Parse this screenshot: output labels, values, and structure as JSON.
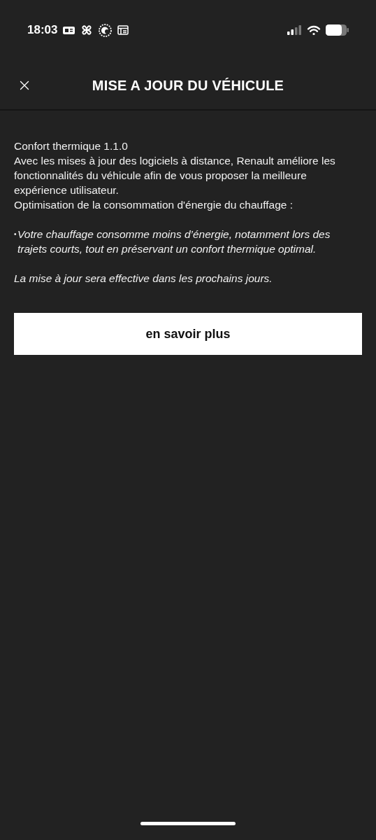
{
  "status_bar": {
    "time": "18:03"
  },
  "header": {
    "title": "MISE A JOUR DU VÉHICULE"
  },
  "content": {
    "version": "Confort thermique 1.1.0",
    "intro": "Avec les mises à jour des logiciels à distance, Renault améliore les fonctionnalités du véhicule afin de vous proposer la meilleure expérience utilisateur.",
    "heading": "Optimisation de la consommation d'énergie du chauffage :",
    "bullets": [
      {
        "marker": "•",
        "text": "Votre chauffage consomme moins d’énergie, notamment lors des trajets courts, tout en préservant un confort thermique optimal."
      }
    ],
    "note": "La mise à jour sera effective dans les prochains jours."
  },
  "button": {
    "label": "en savoir plus"
  }
}
